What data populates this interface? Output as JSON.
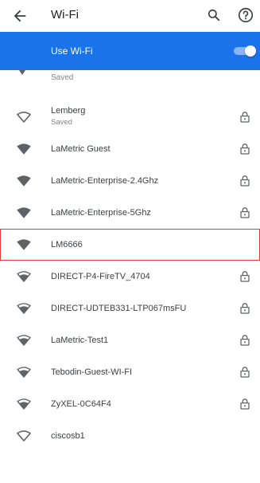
{
  "appbar": {
    "title": "Wi-Fi",
    "back_icon": "arrow-back-icon",
    "search_icon": "search-icon",
    "help_icon": "help-icon"
  },
  "use_wifi": {
    "label": "Use Wi-Fi",
    "enabled": true,
    "color": "#1a73e8"
  },
  "partial_row": {
    "subtitle": "Saved"
  },
  "networks": [
    {
      "name": "Lemberg",
      "subtitle": "Saved",
      "signal": "outline",
      "locked": true
    },
    {
      "name": "LaMetric Guest",
      "subtitle": "",
      "signal": "full",
      "locked": true
    },
    {
      "name": "LaMetric-Enterprise-2.4Ghz",
      "subtitle": "",
      "signal": "full",
      "locked": true
    },
    {
      "name": "LaMetric-Enterprise-5Ghz",
      "subtitle": "",
      "signal": "full",
      "locked": true
    },
    {
      "name": "LM6666",
      "subtitle": "",
      "signal": "full",
      "locked": false,
      "highlighted": true
    },
    {
      "name": "DIRECT-P4-FireTV_4704",
      "subtitle": "",
      "signal": "medium",
      "locked": true
    },
    {
      "name": "DIRECT-UDTEB331-LTP067msFU",
      "subtitle": "",
      "signal": "medium",
      "locked": true
    },
    {
      "name": "LaMetric-Test1",
      "subtitle": "",
      "signal": "medium",
      "locked": true
    },
    {
      "name": "Tebodin-Guest-WI-FI",
      "subtitle": "",
      "signal": "medium",
      "locked": true
    },
    {
      "name": "ZyXEL-0C64F4",
      "subtitle": "",
      "signal": "medium",
      "locked": true
    },
    {
      "name": "ciscosb1",
      "subtitle": "",
      "signal": "outline",
      "locked": false
    }
  ],
  "highlight_color": "#e53935"
}
